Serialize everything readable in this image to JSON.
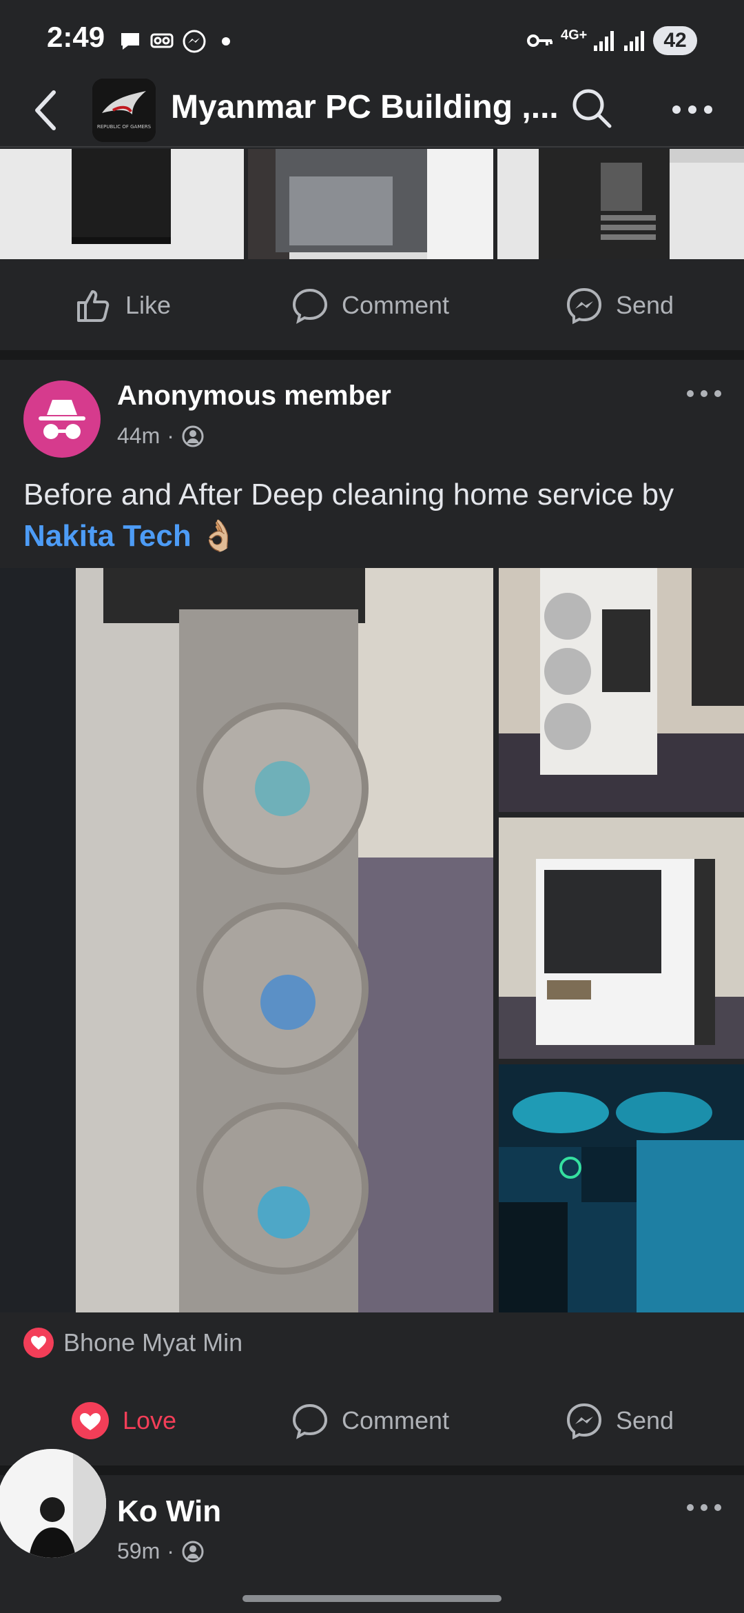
{
  "status_bar": {
    "time": "2:49",
    "network": "4G+",
    "battery": "42"
  },
  "header": {
    "title": "Myanmar PC Building ,...",
    "logo_text": "REPUBLIC OF GAMERS"
  },
  "actions_top": {
    "like": "Like",
    "comment": "Comment",
    "send": "Send"
  },
  "post": {
    "author": "Anonymous member",
    "time": "44m",
    "separator": "·",
    "text": "Before and After Deep cleaning home service by ",
    "mention": "Nakita Tech",
    "emoji": "👌🏼",
    "reaction_name": "Bhone Myat Min",
    "actions": {
      "love": "Love",
      "comment": "Comment",
      "send": "Send"
    }
  },
  "next_post": {
    "author": "Ko Win",
    "time": "59m",
    "separator": "·"
  },
  "colors": {
    "background": "#242527",
    "separator": "#18191a",
    "text_secondary": "#b0b3b8",
    "mention": "#4d9cf6",
    "love": "#f33e58",
    "anon_avatar": "#d63b8d"
  }
}
